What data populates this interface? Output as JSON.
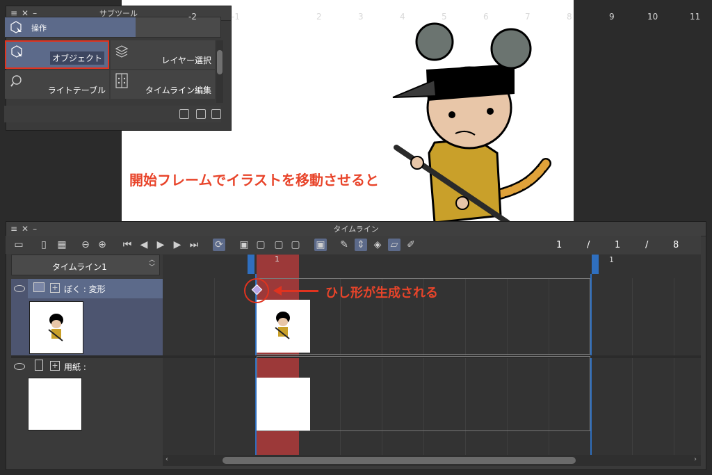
{
  "canvas": {
    "annotation": "開始フレームでイラストを移動させると"
  },
  "subtool_panel": {
    "title": "サブツール",
    "group_label": "操作",
    "tools": [
      {
        "label": "オブジェクト",
        "selected": true
      },
      {
        "label": "レイヤー選択"
      },
      {
        "label": "ライトテーブル"
      },
      {
        "label": "タイムライン編集"
      }
    ]
  },
  "timeline_panel": {
    "title": "タイムライン",
    "timeline_name": "タイムライン1",
    "current_frame": "1",
    "slash1": "/",
    "start_frame": "1",
    "slash2": "/",
    "end_frame": "8",
    "playhead_label": "1",
    "ruler_labels": [
      "-2",
      "-1",
      "1",
      "2",
      "3",
      "4",
      "5",
      "6",
      "7",
      "8",
      "9",
      "10",
      "11"
    ],
    "ruler_extra": "1",
    "layers": [
      {
        "name": "ぼく : 変形"
      },
      {
        "name": "用紙 :"
      }
    ],
    "annotation": "ひし形が生成される"
  },
  "colors": {
    "accent_red": "#e0331f",
    "selection_blue": "#5c6a8a",
    "playhead": "#a23a3a",
    "keyframe": "#b7a6e6"
  }
}
